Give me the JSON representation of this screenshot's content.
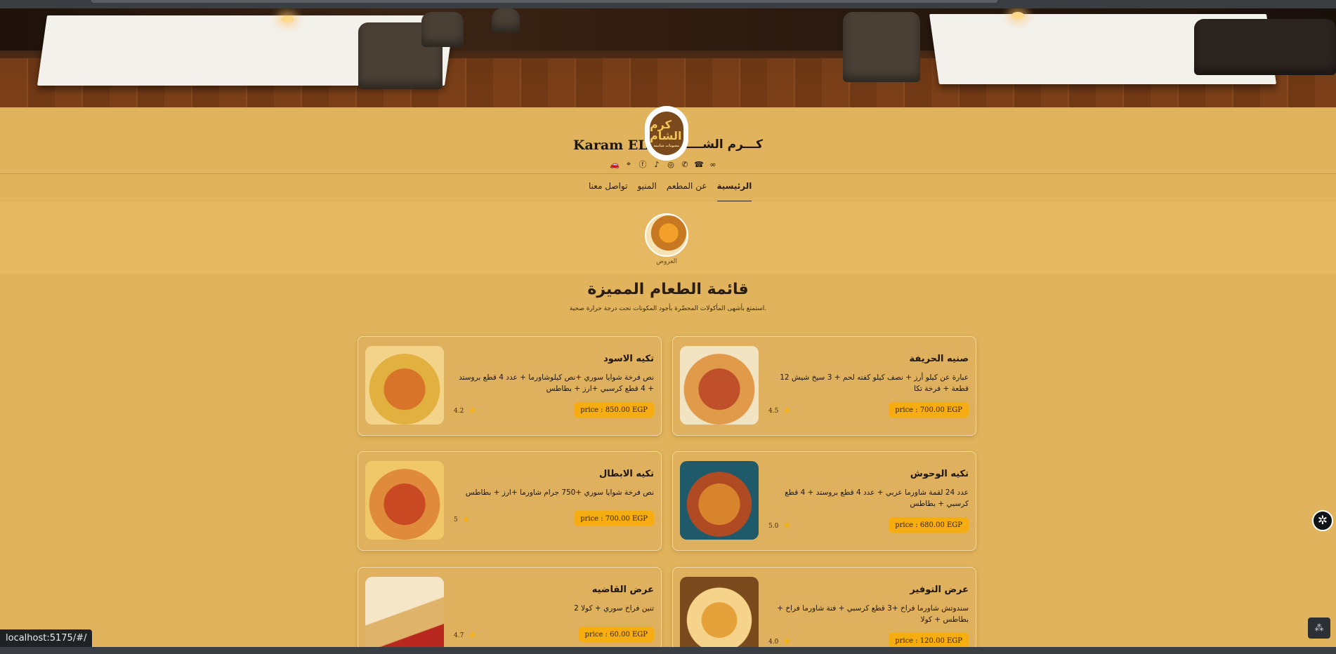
{
  "brand": {
    "name_en": "Karam EL-S",
    "name_ar": "كـــرم الشــــــ",
    "logo_text_main": "كرم الشام",
    "logo_text_sub": "مشويات شامية"
  },
  "socials": [
    "car-icon",
    "location-icon",
    "facebook-icon",
    "tiktok-icon",
    "instagram-icon",
    "whatsapp-icon",
    "phone-icon",
    "link-icon"
  ],
  "nav": {
    "items": [
      {
        "label": "الرئيسية",
        "active": true
      },
      {
        "label": "عن المطعم",
        "active": false
      },
      {
        "label": "المنيو",
        "active": false
      },
      {
        "label": "تواصل معنا",
        "active": false
      }
    ]
  },
  "category": {
    "label": "العروض"
  },
  "section": {
    "title": "قائمة الطعام المميزة",
    "subtitle": "استمتع بأشهى المأكولات المحضّرة بأجود المكونات تحت درجة حرارة صحية."
  },
  "items": [
    {
      "name": "صنيه الحريفة",
      "desc": "عبارة عن كيلو أرز + نصف كيلو كفته لحم + 3 سيخ شيش 12 قطعة + فرخة تكا",
      "price": "price : 700.00 EGP",
      "rating": "4.5"
    },
    {
      "name": "تكيه الاسود",
      "desc": "نص فرخة شوايا سوري +نص كيلوشاورما + عدد 4 قطع بروستد + 4 قطع كرسبي +ارز + بطاطس",
      "price": "price : 850.00 EGP",
      "rating": "4.2"
    },
    {
      "name": "تكيه الوحوش",
      "desc": "عدد 24 لقمة شاورما عربي + عدد 4 قطع بروستد + 4 قطع كرسبي + بطاطس",
      "price": "price : 680.00 EGP",
      "rating": "5.0"
    },
    {
      "name": "تكيه الابطال",
      "desc": "نص فرخة شوايا سوري +750 جرام شاورما +ارز + بطاطس",
      "price": "price : 700.00 EGP",
      "rating": "5"
    },
    {
      "name": "عرض التوفير",
      "desc": "سندوتش شاورما فراخ +3 قطع كرسبي + فتة شاورما فراخ + بطاطس + كولا",
      "price": "price : 120.00 EGP",
      "rating": "4.0"
    },
    {
      "name": "عرض القاضيه",
      "desc": "تنين فراخ سوري + كولا 2",
      "price": "price : 60.00 EGP",
      "rating": "4.7"
    }
  ],
  "colors": {
    "page_bg": "#e0b35c",
    "price_pill": "#f6ad12",
    "star": "#f2b10d"
  },
  "status": {
    "url": "localhost:5175/#/"
  }
}
